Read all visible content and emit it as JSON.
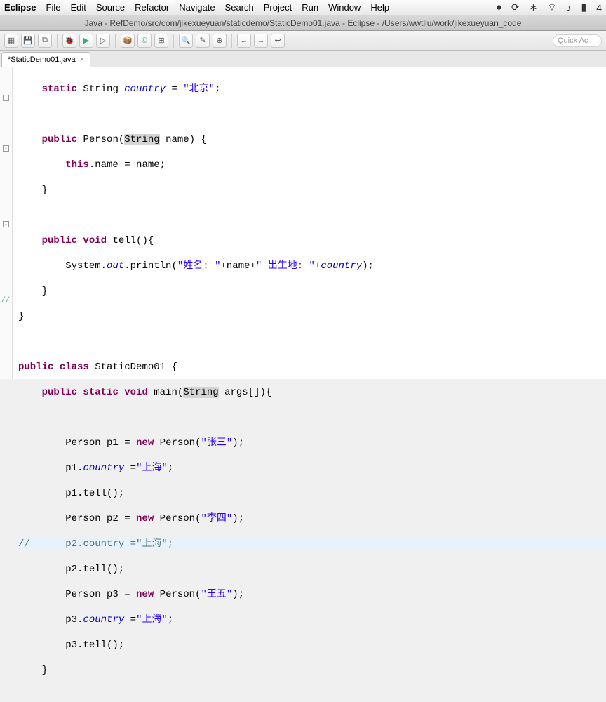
{
  "menubar": {
    "app": "Eclipse",
    "items": [
      "File",
      "Edit",
      "Source",
      "Refactor",
      "Navigate",
      "Search",
      "Project",
      "Run",
      "Window",
      "Help"
    ],
    "time": "4"
  },
  "titlebar": {
    "text": "Java - RefDemo/src/com/jikexueyuan/staticdemo/StaticDemo01.java - Eclipse - /Users/wwtliu/work/jikexueyuan_code"
  },
  "quick_access_placeholder": "Quick Ac",
  "tab": {
    "label": "*StaticDemo01.java",
    "close": "×"
  },
  "code": {
    "l1": {
      "indent": "    ",
      "kw": "static",
      "type": " String ",
      "id": "country",
      "eq": " = ",
      "str": "\"北京\"",
      "end": ";"
    },
    "l2": "",
    "l3": {
      "indent": "    ",
      "kw": "public",
      "sp": " ",
      "ctor": "Person(",
      "argtype": "String",
      "argname": " name) {"
    },
    "l4": {
      "indent": "        ",
      "kw": "this",
      "rest": ".name = name;"
    },
    "l5": {
      "indent": "    ",
      "text": "}"
    },
    "l6": "",
    "l7": {
      "indent": "    ",
      "kw1": "public",
      "kw2": " void",
      "name": " tell(){"
    },
    "l8": {
      "indent": "        ",
      "sys": "System.",
      "out": "out",
      "call": ".println(",
      "s1": "\"姓名: \"",
      "p1": "+name+",
      "s2": "\" 出生地: \"",
      "p2": "+",
      "fld": "country",
      "end": ");"
    },
    "l9": {
      "indent": "    ",
      "text": "}"
    },
    "l10": {
      "text": "}"
    },
    "l11": "",
    "l12": {
      "kw1": "public",
      "kw2": " class",
      "name": " StaticDemo01 {"
    },
    "l13": {
      "indent": "    ",
      "kw1": "public",
      "kw2": " static",
      "kw3": " void",
      "name": " main(",
      "argtype": "String",
      "argrest": " args[]){"
    },
    "l14": "",
    "l15": {
      "indent": "        ",
      "t": "Person p1 = ",
      "kw": "new",
      "rest": " Person(",
      "str": "\"张三\"",
      "end": ");"
    },
    "l16": {
      "indent": "        ",
      "pre": "p1.",
      "fld": "country",
      "mid": " =",
      "str": "\"上海\"",
      "end": ";"
    },
    "l17": {
      "indent": "        ",
      "text": "p1.tell();"
    },
    "l18": {
      "indent": "        ",
      "t": "Person p2 = ",
      "kw": "new",
      "rest": " Person(",
      "str": "\"李四\"",
      "end": ");"
    },
    "l19": {
      "cm": "//",
      "indent": "      ",
      "pre": "p2.",
      "fld": "country",
      "mid": " =",
      "str": "\"上海\"",
      "end": ";"
    },
    "l20": {
      "indent": "        ",
      "text": "p2.tell();"
    },
    "l21": {
      "indent": "        ",
      "t": "Person p3 = ",
      "kw": "new",
      "rest": " Person(",
      "str": "\"王五\"",
      "end": ");"
    },
    "l22": {
      "indent": "        ",
      "pre": "p3.",
      "fld": "country",
      "mid": " =",
      "str": "\"上海\"",
      "end": ";"
    },
    "l23": {
      "indent": "        ",
      "text": "p3.tell();"
    },
    "l24": {
      "indent": "    ",
      "text": "}"
    }
  },
  "icons": {
    "wifi": "⚡︎",
    "vol": "🔊",
    "battery": "🔋",
    "menu_extra": "◧"
  }
}
